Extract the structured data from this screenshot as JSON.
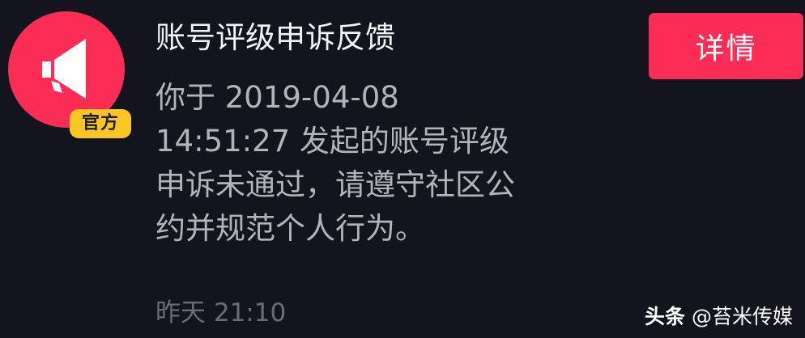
{
  "notification": {
    "avatar_icon": "megaphone-icon",
    "badge": "官方",
    "title": "账号评级申诉反馈",
    "message_lines": [
      "你于 2019-04-08",
      "14:51:27 发起的账号评级",
      "申诉未通过，请遵守社区公",
      "约并规范个人行为。"
    ],
    "time": "昨天 21:10",
    "detail_button": "详情"
  },
  "watermark": {
    "brand": "头条",
    "handle": "@苔米传媒"
  },
  "colors": {
    "accent": "#fb2c55",
    "badge": "#f9c623",
    "background": "#14141f"
  }
}
